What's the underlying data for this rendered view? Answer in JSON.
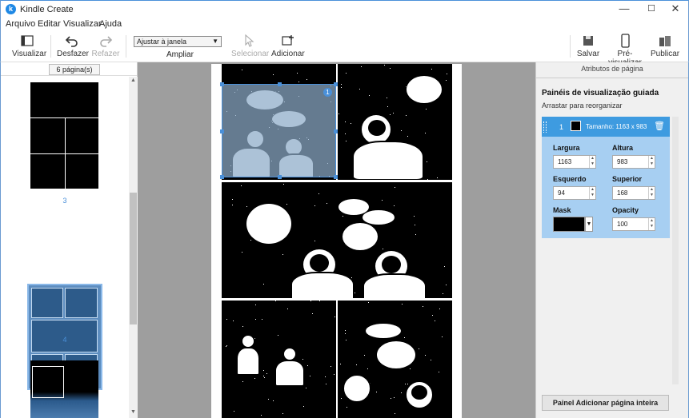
{
  "window": {
    "title": "Kindle Create",
    "app_icon_letter": "k",
    "controls": [
      "—",
      "☐",
      "✕"
    ]
  },
  "menu": [
    "Arquivo",
    "Editar",
    "Visualizar",
    "Ajuda"
  ],
  "toolbar": {
    "visualizar": "Visualizar",
    "desfazer": "Desfazer",
    "refazer": "Refazer",
    "zoom_value": "Ajustar à janela",
    "ampliar": "Ampliar",
    "selecionar": "Selecionar",
    "adicionar": "Adicionar",
    "salvar": "Salvar",
    "pre_visualizar": "Pré-visualizar",
    "publicar": "Publicar"
  },
  "left_panel": {
    "page_count": "6 página(s)",
    "thumbs": [
      {
        "label": "3"
      },
      {
        "label": "4"
      }
    ]
  },
  "right_panel": {
    "title": "Atributos de página",
    "heading": "Painéis de visualização guiada",
    "subheading": "Arrastar para reorganizar",
    "panel": {
      "number": "1",
      "size": "Tamanho: 1163 x 983",
      "largura_label": "Largura",
      "largura": "1163",
      "altura_label": "Altura",
      "altura": "983",
      "esquerdo_label": "Esquerdo",
      "esquerdo": "94",
      "superior_label": "Superior",
      "superior": "168",
      "mask_label": "Mask",
      "opacity_label": "Opacity",
      "opacity": "100"
    },
    "add_button": "Painel Adicionar página inteira"
  },
  "colors": {
    "accent": "#3e9be0",
    "card": "#a7cff2",
    "canvas": "#9e9e9e"
  }
}
